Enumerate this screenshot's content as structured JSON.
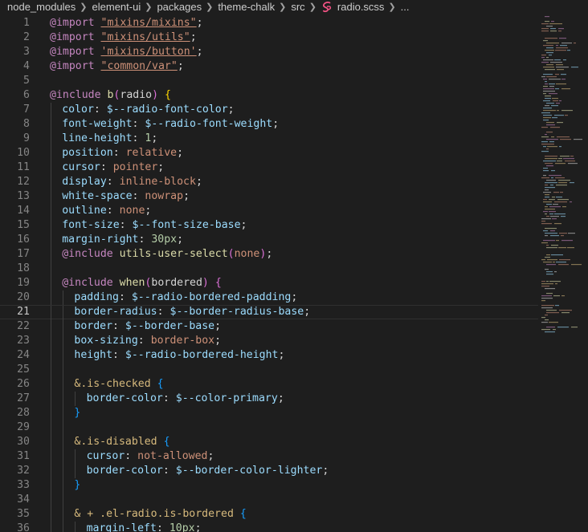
{
  "breadcrumb": {
    "items": [
      "node_modules",
      "element-ui",
      "packages",
      "theme-chalk",
      "src"
    ],
    "file": "radio.scss",
    "ellipsis": "...",
    "separator_icon": "chevron-right-icon",
    "file_icon": "scss-file-icon"
  },
  "editor": {
    "current_line": 21,
    "lines": [
      {
        "n": "1",
        "indent": 0,
        "tokens": [
          [
            "kw",
            "@import "
          ],
          [
            "str",
            "\"mixins/mixins\""
          ],
          [
            "punc",
            ";"
          ]
        ]
      },
      {
        "n": "2",
        "indent": 0,
        "tokens": [
          [
            "kw",
            "@import "
          ],
          [
            "str",
            "\"mixins/utils\""
          ],
          [
            "punc",
            ";"
          ]
        ]
      },
      {
        "n": "3",
        "indent": 0,
        "tokens": [
          [
            "kw",
            "@import "
          ],
          [
            "str",
            "'mixins/button'"
          ],
          [
            "punc",
            ";"
          ]
        ]
      },
      {
        "n": "4",
        "indent": 0,
        "tokens": [
          [
            "kw",
            "@import "
          ],
          [
            "str",
            "\"common/var\""
          ],
          [
            "punc",
            ";"
          ]
        ]
      },
      {
        "n": "5",
        "indent": 0,
        "tokens": []
      },
      {
        "n": "6",
        "indent": 0,
        "tokens": [
          [
            "kw",
            "@include "
          ],
          [
            "fn",
            "b"
          ],
          [
            "b2",
            "("
          ],
          [
            "plain",
            "radio"
          ],
          [
            "b2",
            ")"
          ],
          [
            "plain",
            " "
          ],
          [
            "b1",
            "{"
          ]
        ]
      },
      {
        "n": "7",
        "indent": 1,
        "tokens": [
          [
            "prop",
            "color"
          ],
          [
            "punc",
            ": "
          ],
          [
            "var",
            "$--radio-font-color"
          ],
          [
            "punc",
            ";"
          ]
        ]
      },
      {
        "n": "8",
        "indent": 1,
        "tokens": [
          [
            "prop",
            "font-weight"
          ],
          [
            "punc",
            ": "
          ],
          [
            "var",
            "$--radio-font-weight"
          ],
          [
            "punc",
            ";"
          ]
        ]
      },
      {
        "n": "9",
        "indent": 1,
        "tokens": [
          [
            "prop",
            "line-height"
          ],
          [
            "punc",
            ": "
          ],
          [
            "num",
            "1"
          ],
          [
            "punc",
            ";"
          ]
        ]
      },
      {
        "n": "10",
        "indent": 1,
        "tokens": [
          [
            "prop",
            "position"
          ],
          [
            "punc",
            ": "
          ],
          [
            "val",
            "relative"
          ],
          [
            "punc",
            ";"
          ]
        ]
      },
      {
        "n": "11",
        "indent": 1,
        "tokens": [
          [
            "prop",
            "cursor"
          ],
          [
            "punc",
            ": "
          ],
          [
            "val",
            "pointer"
          ],
          [
            "punc",
            ";"
          ]
        ]
      },
      {
        "n": "12",
        "indent": 1,
        "tokens": [
          [
            "prop",
            "display"
          ],
          [
            "punc",
            ": "
          ],
          [
            "val",
            "inline-block"
          ],
          [
            "punc",
            ";"
          ]
        ]
      },
      {
        "n": "13",
        "indent": 1,
        "tokens": [
          [
            "prop",
            "white-space"
          ],
          [
            "punc",
            ": "
          ],
          [
            "val",
            "nowrap"
          ],
          [
            "punc",
            ";"
          ]
        ]
      },
      {
        "n": "14",
        "indent": 1,
        "tokens": [
          [
            "prop",
            "outline"
          ],
          [
            "punc",
            ": "
          ],
          [
            "val",
            "none"
          ],
          [
            "punc",
            ";"
          ]
        ]
      },
      {
        "n": "15",
        "indent": 1,
        "tokens": [
          [
            "prop",
            "font-size"
          ],
          [
            "punc",
            ": "
          ],
          [
            "var",
            "$--font-size-base"
          ],
          [
            "punc",
            ";"
          ]
        ]
      },
      {
        "n": "16",
        "indent": 1,
        "tokens": [
          [
            "prop",
            "margin-right"
          ],
          [
            "punc",
            ": "
          ],
          [
            "num",
            "30px"
          ],
          [
            "punc",
            ";"
          ]
        ]
      },
      {
        "n": "17",
        "indent": 1,
        "tokens": [
          [
            "kw",
            "@include "
          ],
          [
            "fn",
            "utils-user-select"
          ],
          [
            "b2",
            "("
          ],
          [
            "val",
            "none"
          ],
          [
            "b2",
            ")"
          ],
          [
            "punc",
            ";"
          ]
        ]
      },
      {
        "n": "18",
        "indent": 1,
        "tokens": []
      },
      {
        "n": "19",
        "indent": 1,
        "tokens": [
          [
            "kw",
            "@include "
          ],
          [
            "fn",
            "when"
          ],
          [
            "b2",
            "("
          ],
          [
            "plain",
            "bordered"
          ],
          [
            "b2",
            ")"
          ],
          [
            "plain",
            " "
          ],
          [
            "b2",
            "{"
          ]
        ]
      },
      {
        "n": "20",
        "indent": 2,
        "tokens": [
          [
            "prop",
            "padding"
          ],
          [
            "punc",
            ": "
          ],
          [
            "var",
            "$--radio-bordered-padding"
          ],
          [
            "punc",
            ";"
          ]
        ]
      },
      {
        "n": "21",
        "indent": 2,
        "tokens": [
          [
            "prop",
            "border-radius"
          ],
          [
            "punc",
            ": "
          ],
          [
            "var",
            "$--border-radius-base"
          ],
          [
            "punc",
            ";"
          ]
        ]
      },
      {
        "n": "22",
        "indent": 2,
        "tokens": [
          [
            "prop",
            "border"
          ],
          [
            "punc",
            ": "
          ],
          [
            "var",
            "$--border-base"
          ],
          [
            "punc",
            ";"
          ]
        ]
      },
      {
        "n": "23",
        "indent": 2,
        "tokens": [
          [
            "prop",
            "box-sizing"
          ],
          [
            "punc",
            ": "
          ],
          [
            "val",
            "border-box"
          ],
          [
            "punc",
            ";"
          ]
        ]
      },
      {
        "n": "24",
        "indent": 2,
        "tokens": [
          [
            "prop",
            "height"
          ],
          [
            "punc",
            ": "
          ],
          [
            "var",
            "$--radio-bordered-height"
          ],
          [
            "punc",
            ";"
          ]
        ]
      },
      {
        "n": "25",
        "indent": 2,
        "tokens": []
      },
      {
        "n": "26",
        "indent": 2,
        "tokens": [
          [
            "sel",
            "&.is-checked"
          ],
          [
            "plain",
            " "
          ],
          [
            "b3",
            "{"
          ]
        ]
      },
      {
        "n": "27",
        "indent": 3,
        "tokens": [
          [
            "prop",
            "border-color"
          ],
          [
            "punc",
            ": "
          ],
          [
            "var",
            "$--color-primary"
          ],
          [
            "punc",
            ";"
          ]
        ]
      },
      {
        "n": "28",
        "indent": 2,
        "tokens": [
          [
            "b3",
            "}"
          ]
        ]
      },
      {
        "n": "29",
        "indent": 2,
        "tokens": []
      },
      {
        "n": "30",
        "indent": 2,
        "tokens": [
          [
            "sel",
            "&.is-disabled"
          ],
          [
            "plain",
            " "
          ],
          [
            "b3",
            "{"
          ]
        ]
      },
      {
        "n": "31",
        "indent": 3,
        "tokens": [
          [
            "prop",
            "cursor"
          ],
          [
            "punc",
            ": "
          ],
          [
            "val",
            "not-allowed"
          ],
          [
            "punc",
            ";"
          ]
        ]
      },
      {
        "n": "32",
        "indent": 3,
        "tokens": [
          [
            "prop",
            "border-color"
          ],
          [
            "punc",
            ": "
          ],
          [
            "var",
            "$--border-color-lighter"
          ],
          [
            "punc",
            ";"
          ]
        ]
      },
      {
        "n": "33",
        "indent": 2,
        "tokens": [
          [
            "b3",
            "}"
          ]
        ]
      },
      {
        "n": "34",
        "indent": 2,
        "tokens": []
      },
      {
        "n": "35",
        "indent": 2,
        "tokens": [
          [
            "sel",
            "& + .el-radio.is-bordered"
          ],
          [
            "plain",
            " "
          ],
          [
            "b3",
            "{"
          ]
        ]
      },
      {
        "n": "36",
        "indent": 3,
        "tokens": [
          [
            "prop",
            "margin-left"
          ],
          [
            "punc",
            ": "
          ],
          [
            "num",
            "10px"
          ],
          [
            "punc",
            ";"
          ]
        ]
      }
    ]
  },
  "colors": {
    "background": "#1e1e1e",
    "keyword": "#c586c0",
    "string": "#ce9178",
    "property": "#9cdcfe",
    "function": "#dcdcaa",
    "number": "#b5cea8",
    "selector": "#d7ba7d",
    "bracket1": "#ffd700",
    "bracket2": "#da70d6",
    "bracket3": "#179fff",
    "line_number": "#858585"
  }
}
